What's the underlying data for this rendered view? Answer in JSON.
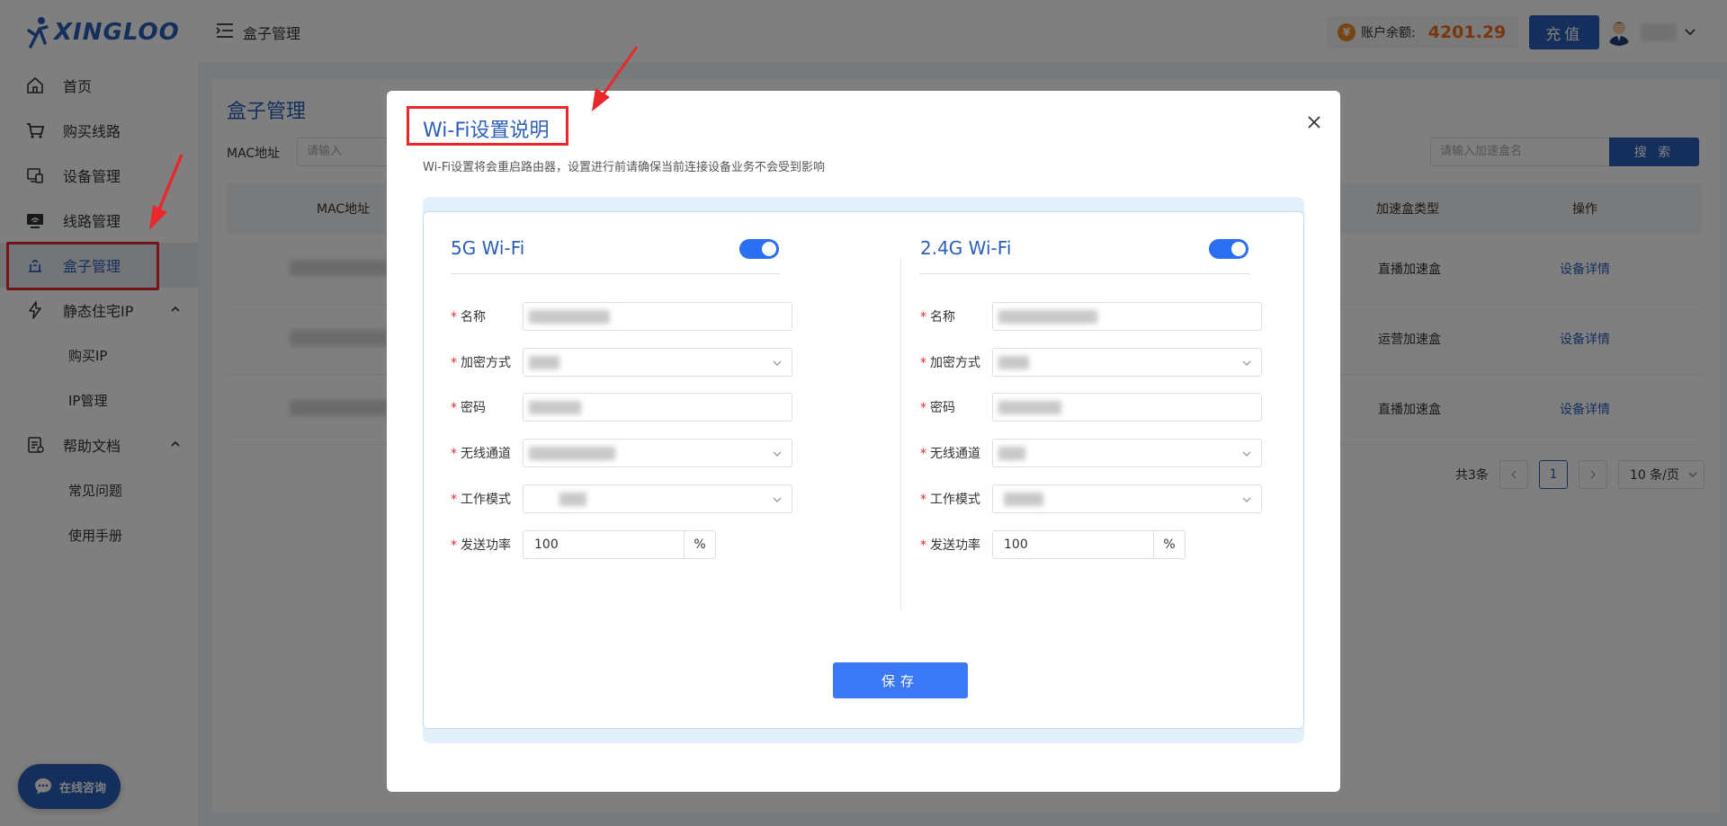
{
  "app": {
    "logo_text": "XINGLOO"
  },
  "sidebar": {
    "items": [
      {
        "label": "首页",
        "icon": "home-icon"
      },
      {
        "label": "购买线路",
        "icon": "cart-icon"
      },
      {
        "label": "设备管理",
        "icon": "device-icon"
      },
      {
        "label": "线路管理",
        "icon": "router-icon"
      },
      {
        "label": "盒子管理",
        "icon": "box-icon",
        "active": true
      },
      {
        "label": "静态住宅IP",
        "icon": "lightning-icon",
        "expanded": true
      },
      {
        "label": "购买IP"
      },
      {
        "label": "IP管理"
      },
      {
        "label": "帮助文档",
        "icon": "doc-icon",
        "expanded": true
      },
      {
        "label": "常见问题"
      },
      {
        "label": "使用手册"
      }
    ],
    "chat_label": "在线咨询"
  },
  "header": {
    "title": "盒子管理",
    "balance_label": "账户余额:",
    "balance_value": "4201.29",
    "recharge_label": "充值"
  },
  "main": {
    "page_title": "盒子管理",
    "filter_label": "MAC地址",
    "filter_placeholder": "请输入",
    "search_placeholder": "请输入加速盒名",
    "search_label": "搜 索",
    "columns": [
      "MAC地址",
      "加速盒类型",
      "操作"
    ],
    "rows": [
      {
        "type": "直播加速盒",
        "op": "设备详情"
      },
      {
        "type": "运营加速盒",
        "op": "设备详情"
      },
      {
        "type": "直播加速盒",
        "op": "设备详情"
      }
    ],
    "pager": {
      "total": "共3条",
      "current": "1",
      "page_size": "10 条/页"
    }
  },
  "modal": {
    "title": "Wi-Fi设置说明",
    "description": "Wi-Fi设置将会重启路由器，设置进行前请确保当前连接设备业务不会受到影响",
    "wifi5": {
      "title": "5G Wi-Fi",
      "enabled": true,
      "fields": {
        "name": "名称",
        "encryption": "加密方式",
        "password": "密码",
        "channel": "无线通道",
        "mode": "工作模式",
        "power": "发送功率"
      },
      "power_value": "100",
      "power_unit": "%"
    },
    "wifi24": {
      "title": "2.4G Wi-Fi",
      "enabled": true,
      "fields": {
        "name": "名称",
        "encryption": "加密方式",
        "password": "密码",
        "channel": "无线通道",
        "mode": "工作模式",
        "power": "发送功率"
      },
      "power_value": "100",
      "power_unit": "%"
    },
    "save_label": "保存"
  },
  "colors": {
    "accent": "#2b5fb8",
    "toggle": "#2b6ff2",
    "balance": "#f06c1a",
    "annotation": "#e8282b"
  }
}
